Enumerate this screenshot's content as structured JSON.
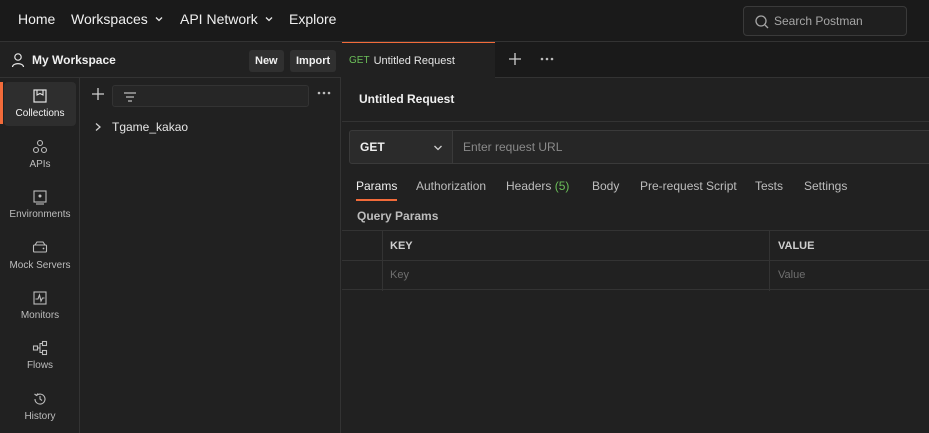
{
  "topbar": {
    "home": "Home",
    "workspaces": "Workspaces",
    "api_network": "API Network",
    "explore": "Explore",
    "search_placeholder": "Search Postman"
  },
  "workspace": {
    "title": "My Workspace",
    "new_label": "New",
    "import_label": "Import"
  },
  "rail": {
    "items": [
      {
        "label": "Collections",
        "icon": "collections-icon",
        "active": true
      },
      {
        "label": "APIs",
        "icon": "apis-icon"
      },
      {
        "label": "Environments",
        "icon": "environments-icon"
      },
      {
        "label": "Mock Servers",
        "icon": "mock-servers-icon"
      },
      {
        "label": "Monitors",
        "icon": "monitors-icon"
      },
      {
        "label": "Flows",
        "icon": "flows-icon"
      },
      {
        "label": "History",
        "icon": "history-icon"
      }
    ]
  },
  "collections": {
    "items": [
      {
        "name": "Tgame_kakao"
      }
    ]
  },
  "tabs": {
    "active": {
      "method": "GET",
      "title": "Untitled Request"
    }
  },
  "request": {
    "title": "Untitled Request",
    "method": "GET",
    "url_placeholder": "Enter request URL",
    "tabs": [
      {
        "label": "Params",
        "active": true
      },
      {
        "label": "Authorization"
      },
      {
        "label": "Headers",
        "count": "(5)"
      },
      {
        "label": "Body"
      },
      {
        "label": "Pre-request Script"
      },
      {
        "label": "Tests"
      },
      {
        "label": "Settings"
      }
    ],
    "query_params_label": "Query Params",
    "table": {
      "headers": [
        "KEY",
        "VALUE"
      ],
      "placeholders": [
        "Key",
        "Value"
      ]
    }
  },
  "colors": {
    "accent": "#f26b3a",
    "get_method": "#6bbf59",
    "background": "#212121"
  }
}
